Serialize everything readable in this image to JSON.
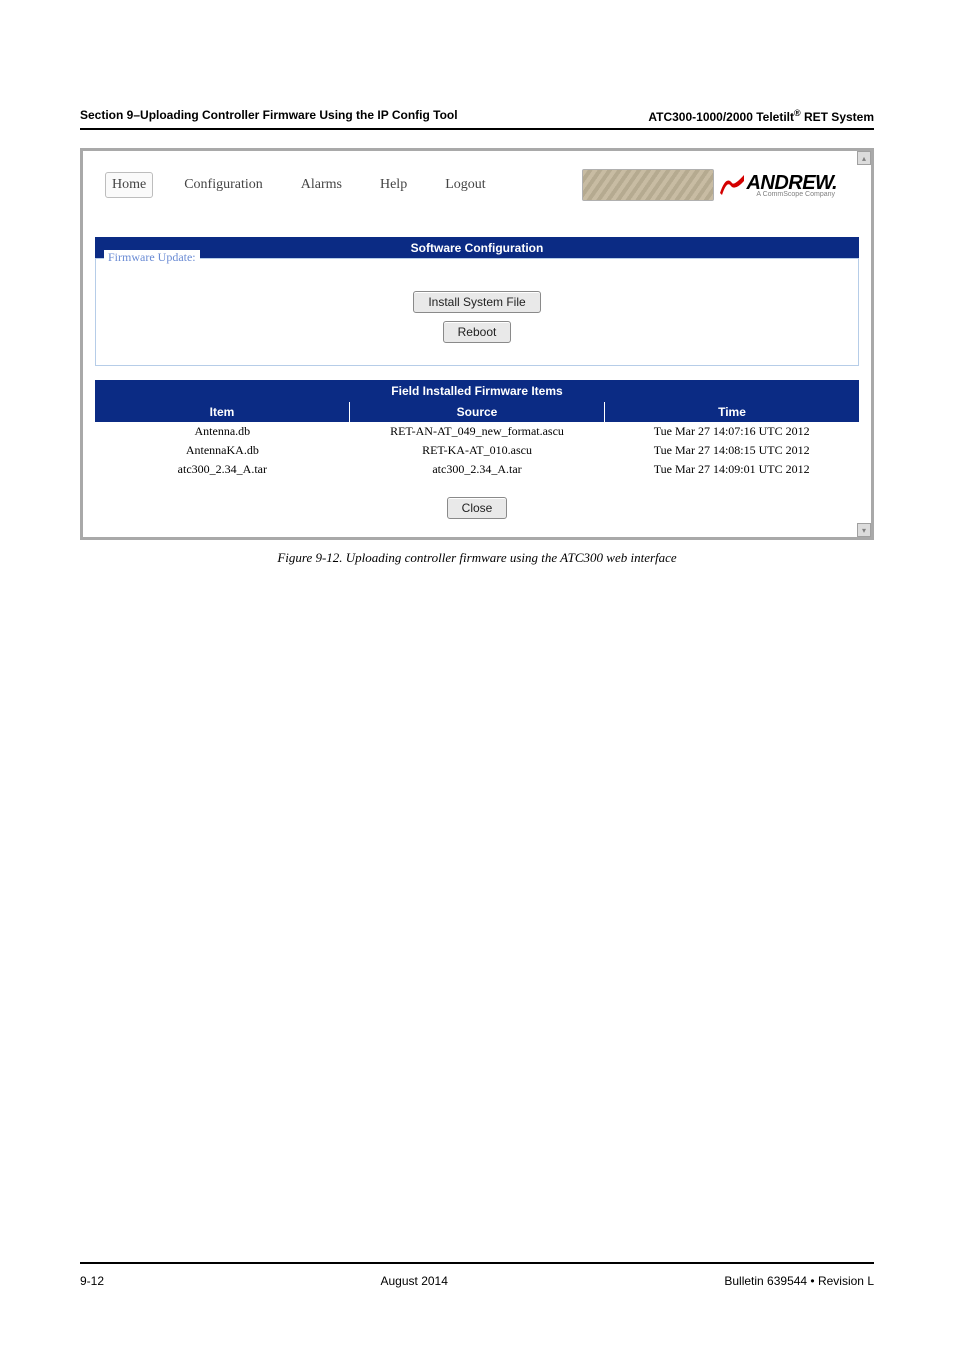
{
  "header": {
    "left": "Section 9–Uploading Controller Firmware Using the IP Config Tool",
    "right_prefix": "ATC300-1000/2000 Teletilt",
    "right_sup": "®",
    "right_suffix": " RET System"
  },
  "nav": {
    "home": "Home",
    "configuration": "Configuration",
    "alarms": "Alarms",
    "help": "Help",
    "logout": "Logout"
  },
  "logo": {
    "brand": "ANDREW.",
    "sub": "A CommScope Company"
  },
  "software_config": {
    "title": "Software Configuration",
    "fieldset_label": "Firmware Update:",
    "install_btn": "Install System File",
    "reboot_btn": "Reboot"
  },
  "table": {
    "title": "Field Installed Firmware Items",
    "cols": {
      "item": "Item",
      "source": "Source",
      "time": "Time"
    },
    "rows": [
      {
        "item": "Antenna.db",
        "source": "RET-AN-AT_049_new_format.ascu",
        "time": "Tue Mar 27 14:07:16 UTC 2012"
      },
      {
        "item": "AntennaKA.db",
        "source": "RET-KA-AT_010.ascu",
        "time": "Tue Mar 27 14:08:15 UTC 2012"
      },
      {
        "item": "atc300_2.34_A.tar",
        "source": "atc300_2.34_A.tar",
        "time": "Tue Mar 27 14:09:01 UTC 2012"
      }
    ],
    "close_btn": "Close"
  },
  "caption": "Figure 9-12.  Uploading controller firmware using the ATC300 web interface",
  "footer": {
    "left": "9-12",
    "center": "August 2014",
    "right": "Bulletin 639544  •  Revision L"
  }
}
